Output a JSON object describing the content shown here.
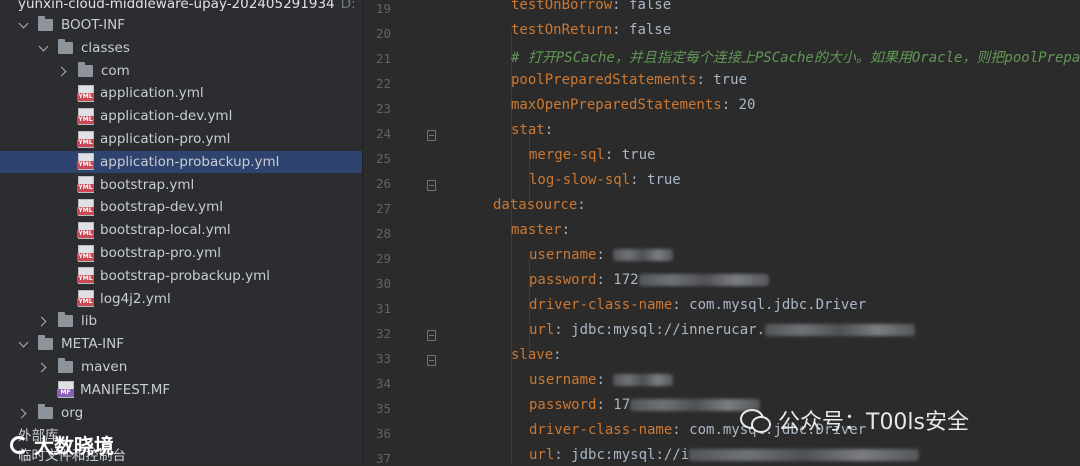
{
  "project": {
    "title": "yunxin-cloud-middleware-upay-202405291934",
    "title_suffix": "D:"
  },
  "tree": [
    {
      "indent": 1,
      "chevron": "down",
      "icon": "folder",
      "label": "BOOT-INF"
    },
    {
      "indent": 2,
      "chevron": "down",
      "icon": "folder",
      "label": "classes"
    },
    {
      "indent": 3,
      "chevron": "right",
      "icon": "folder",
      "label": "com"
    },
    {
      "indent": 3,
      "chevron": "none",
      "icon": "yml",
      "label": "application.yml"
    },
    {
      "indent": 3,
      "chevron": "none",
      "icon": "yml",
      "label": "application-dev.yml"
    },
    {
      "indent": 3,
      "chevron": "none",
      "icon": "yml",
      "label": "application-pro.yml"
    },
    {
      "indent": 3,
      "chevron": "none",
      "icon": "yml",
      "label": "application-probackup.yml",
      "selected": true
    },
    {
      "indent": 3,
      "chevron": "none",
      "icon": "yml",
      "label": "bootstrap.yml"
    },
    {
      "indent": 3,
      "chevron": "none",
      "icon": "yml",
      "label": "bootstrap-dev.yml"
    },
    {
      "indent": 3,
      "chevron": "none",
      "icon": "yml",
      "label": "bootstrap-local.yml"
    },
    {
      "indent": 3,
      "chevron": "none",
      "icon": "yml",
      "label": "bootstrap-pro.yml"
    },
    {
      "indent": 3,
      "chevron": "none",
      "icon": "yml",
      "label": "bootstrap-probackup.yml"
    },
    {
      "indent": 3,
      "chevron": "none",
      "icon": "yml",
      "label": "log4j2.yml"
    },
    {
      "indent": 2,
      "chevron": "right",
      "icon": "folder",
      "label": "lib"
    },
    {
      "indent": 1,
      "chevron": "down",
      "icon": "folder",
      "label": "META-INF"
    },
    {
      "indent": 2,
      "chevron": "right",
      "icon": "folder",
      "label": "maven"
    },
    {
      "indent": 2,
      "chevron": "none",
      "icon": "mf",
      "label": "MANIFEST.MF"
    },
    {
      "indent": 1,
      "chevron": "right",
      "icon": "folder",
      "label": "org"
    }
  ],
  "tree_bottom": {
    "line1": "外部库",
    "line2": "临时文件和控制台"
  },
  "icon_badges": {
    "yml": "YML",
    "mf": "MF"
  },
  "gutter": {
    "line_numbers": [
      "19",
      "20",
      "21",
      "22",
      "23",
      "24",
      "25",
      "26",
      "27",
      "28",
      "29",
      "30",
      "31",
      "32",
      "33",
      "34",
      "35",
      "36",
      "37"
    ]
  },
  "code": [
    {
      "indent": 1,
      "key": "testOnBorrow",
      "sep": ": ",
      "value": "false"
    },
    {
      "indent": 1,
      "key": "testOnReturn",
      "sep": ": ",
      "value": "false"
    },
    {
      "indent": 1,
      "comment": "# 打开PSCache，并且指定每个连接上PSCache的大小。如果用Oracle，则把poolPreparedStatements配置为true，mysql可以配置为false。"
    },
    {
      "indent": 1,
      "key": "poolPreparedStatements",
      "sep": ": ",
      "value": "true"
    },
    {
      "indent": 1,
      "key": "maxOpenPreparedStatements",
      "sep": ": ",
      "value": "20"
    },
    {
      "indent": 1,
      "key": "stat",
      "sep": ":",
      "value": ""
    },
    {
      "indent": 2,
      "key": "merge-sql",
      "sep": ": ",
      "value": "true"
    },
    {
      "indent": 2,
      "key": "log-slow-sql",
      "sep": ": ",
      "value": "true"
    },
    {
      "indent": 0,
      "key": "datasource",
      "sep": ":",
      "value": ""
    },
    {
      "indent": 1,
      "key": "master",
      "sep": ":",
      "value": ""
    },
    {
      "indent": 2,
      "key": "username",
      "sep": ": ",
      "value": "",
      "redacted": true
    },
    {
      "indent": 2,
      "key": "password",
      "sep": ": ",
      "value": "172",
      "redacted": true
    },
    {
      "indent": 2,
      "key": "driver-class-name",
      "sep": ": ",
      "value": "com.mysql.jdbc.Driver"
    },
    {
      "indent": 2,
      "key": "url",
      "sep": ": ",
      "value": "jdbc:mysql://innerucar.",
      "redacted": true
    },
    {
      "indent": 1,
      "key": "slave",
      "sep": ":",
      "value": ""
    },
    {
      "indent": 2,
      "key": "username",
      "sep": ": ",
      "value": "",
      "redacted": true
    },
    {
      "indent": 2,
      "key": "password",
      "sep": ": ",
      "value": "17",
      "redacted": true
    },
    {
      "indent": 2,
      "key": "driver-class-name",
      "sep": ": ",
      "value": "com.mysql.jdbc.Driver"
    },
    {
      "indent": 2,
      "key": "url",
      "sep": ": ",
      "value": "jdbc:mysql://i",
      "redacted": true
    }
  ],
  "watermark": {
    "right": "公众号：T00ls安全",
    "left": "大数晓境"
  },
  "colors": {
    "key": "#cc7832",
    "value": "#a9b7c6",
    "comment": "#629755",
    "selection": "#2e436e"
  }
}
